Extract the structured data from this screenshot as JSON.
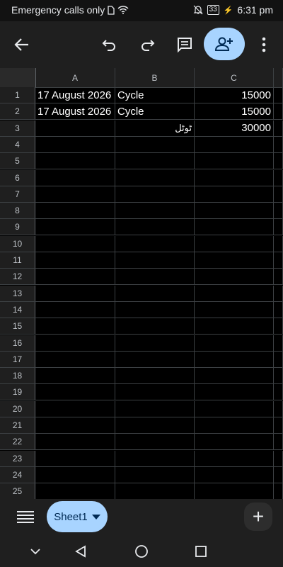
{
  "status_bar": {
    "left_text": "Emergency calls only",
    "battery_level": "33",
    "time": "6:31 pm"
  },
  "toolbar": {
    "back_icon": "arrow-left-icon",
    "undo_icon": "undo-icon",
    "redo_icon": "redo-icon",
    "comment_icon": "comment-icon",
    "share_icon": "add-person-icon",
    "more_icon": "more-vert-icon"
  },
  "grid": {
    "columns": [
      "A",
      "B",
      "C"
    ],
    "rows": [
      {
        "num": "1",
        "a": "17 August 2026",
        "b": "Cycle",
        "c": "15000"
      },
      {
        "num": "2",
        "a": "17 August 2026",
        "b": "Cycle",
        "c": "15000"
      },
      {
        "num": "3",
        "a": "",
        "b": "ٹوٹل",
        "c": "30000"
      },
      {
        "num": "4",
        "a": "",
        "b": "",
        "c": ""
      },
      {
        "num": "5",
        "a": "",
        "b": "",
        "c": ""
      },
      {
        "num": "6",
        "a": "",
        "b": "",
        "c": ""
      },
      {
        "num": "7",
        "a": "",
        "b": "",
        "c": ""
      },
      {
        "num": "8",
        "a": "",
        "b": "",
        "c": ""
      },
      {
        "num": "9",
        "a": "",
        "b": "",
        "c": ""
      },
      {
        "num": "10",
        "a": "",
        "b": "",
        "c": ""
      },
      {
        "num": "11",
        "a": "",
        "b": "",
        "c": ""
      },
      {
        "num": "12",
        "a": "",
        "b": "",
        "c": ""
      },
      {
        "num": "13",
        "a": "",
        "b": "",
        "c": ""
      },
      {
        "num": "14",
        "a": "",
        "b": "",
        "c": ""
      },
      {
        "num": "15",
        "a": "",
        "b": "",
        "c": ""
      },
      {
        "num": "16",
        "a": "",
        "b": "",
        "c": ""
      },
      {
        "num": "17",
        "a": "",
        "b": "",
        "c": ""
      },
      {
        "num": "18",
        "a": "",
        "b": "",
        "c": ""
      },
      {
        "num": "19",
        "a": "",
        "b": "",
        "c": ""
      },
      {
        "num": "20",
        "a": "",
        "b": "",
        "c": ""
      },
      {
        "num": "21",
        "a": "",
        "b": "",
        "c": ""
      },
      {
        "num": "22",
        "a": "",
        "b": "",
        "c": ""
      },
      {
        "num": "23",
        "a": "",
        "b": "",
        "c": ""
      },
      {
        "num": "24",
        "a": "",
        "b": "",
        "c": ""
      },
      {
        "num": "25",
        "a": "",
        "b": "",
        "c": ""
      }
    ]
  },
  "sheet_bar": {
    "menu_icon": "sheets-list-icon",
    "active_sheet": "Sheet1",
    "add_icon": "plus-icon"
  },
  "nav_bar": {
    "icons": [
      "chevron-down-icon",
      "back-triangle-icon",
      "home-circle-icon",
      "recents-square-icon"
    ]
  },
  "colors": {
    "accent": "#a8d4ff",
    "background": "#000000",
    "chrome": "#1f1f1f"
  }
}
